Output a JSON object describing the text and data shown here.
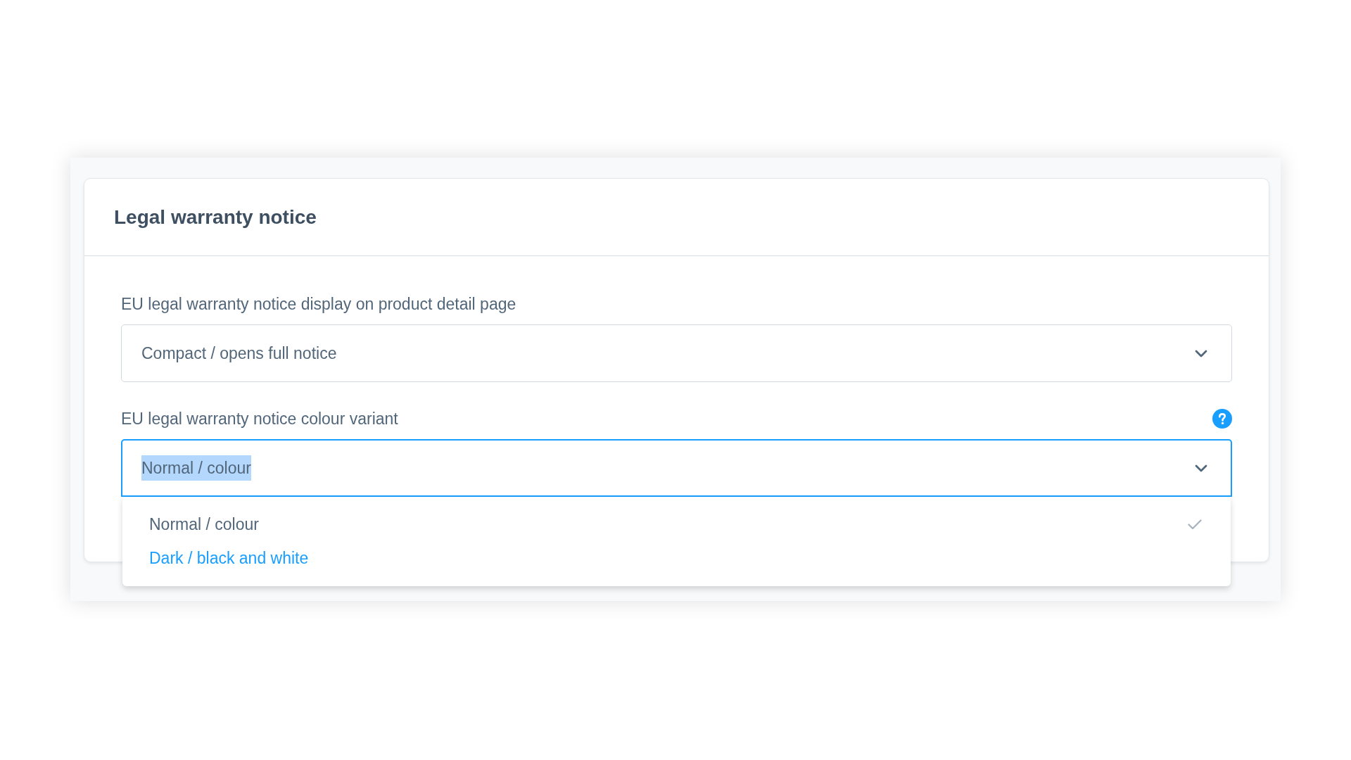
{
  "card": {
    "title": "Legal warranty notice"
  },
  "fields": [
    {
      "label": "EU legal warranty notice display on product detail page",
      "value": "Compact / opens full notice",
      "focused": false,
      "help": false,
      "text_selected": false
    },
    {
      "label": "EU legal warranty notice colour variant",
      "value": "Normal / colour",
      "focused": true,
      "help": true,
      "text_selected": true,
      "dropdown": {
        "options": [
          {
            "label": "Normal / colour",
            "selected": true,
            "highlighted": false
          },
          {
            "label": "Dark / black and white",
            "selected": false,
            "highlighted": true
          }
        ]
      }
    }
  ]
}
